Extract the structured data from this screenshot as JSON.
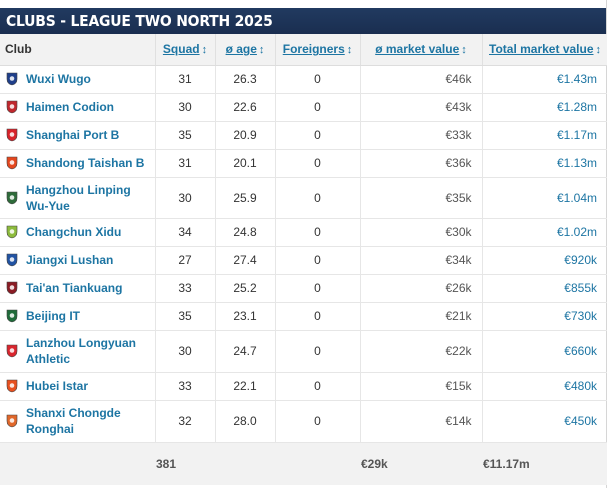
{
  "title": "CLUBS - LEAGUE TWO NORTH 2025",
  "columns": {
    "club": "Club",
    "squad": "Squad",
    "age": "ø age",
    "foreigners": "Foreigners",
    "market_value": "ø market value",
    "total_market_value": "Total market value",
    "sort_icon": "↕"
  },
  "rows": [
    {
      "club": "Wuxi Wugo",
      "squad": "31",
      "age": "26.3",
      "foreigners": "0",
      "market_value": "€46k",
      "total_market_value": "€1.43m",
      "crest_color": "#1f3f8a",
      "crest_icon": "wuxi-wugo-crest-icon"
    },
    {
      "club": "Haimen Codion",
      "squad": "30",
      "age": "22.6",
      "foreigners": "0",
      "market_value": "€43k",
      "total_market_value": "€1.28m",
      "crest_color": "#c0272d",
      "crest_icon": "haimen-codion-crest-icon"
    },
    {
      "club": "Shanghai Port B",
      "squad": "35",
      "age": "20.9",
      "foreigners": "0",
      "market_value": "€33k",
      "total_market_value": "€1.17m",
      "crest_color": "#d8232a",
      "crest_icon": "shanghai-port-b-crest-icon"
    },
    {
      "club": "Shandong Taishan B",
      "squad": "31",
      "age": "20.1",
      "foreigners": "0",
      "market_value": "€36k",
      "total_market_value": "€1.13m",
      "crest_color": "#e4471e",
      "crest_icon": "shandong-taishan-b-crest-icon"
    },
    {
      "club": "Hangzhou Linping Wu-Yue",
      "squad": "30",
      "age": "25.9",
      "foreigners": "0",
      "market_value": "€35k",
      "total_market_value": "€1.04m",
      "crest_color": "#2e6b3a",
      "crest_icon": "hangzhou-linping-wu-yue-crest-icon"
    },
    {
      "club": "Changchun Xidu",
      "squad": "34",
      "age": "24.8",
      "foreigners": "0",
      "market_value": "€30k",
      "total_market_value": "€1.02m",
      "crest_color": "#8dbb3c",
      "crest_icon": "changchun-xidu-crest-icon"
    },
    {
      "club": "Jiangxi Lushan",
      "squad": "27",
      "age": "27.4",
      "foreigners": "0",
      "market_value": "€34k",
      "total_market_value": "€920k",
      "crest_color": "#2153a3",
      "crest_icon": "jiangxi-lushan-crest-icon"
    },
    {
      "club": "Tai'an Tiankuang",
      "squad": "33",
      "age": "25.2",
      "foreigners": "0",
      "market_value": "€26k",
      "total_market_value": "€855k",
      "crest_color": "#8a1c24",
      "crest_icon": "taian-tiankuang-crest-icon"
    },
    {
      "club": "Beijing IT",
      "squad": "35",
      "age": "23.1",
      "foreigners": "0",
      "market_value": "€21k",
      "total_market_value": "€730k",
      "crest_color": "#1f6b3a",
      "crest_icon": "beijing-it-crest-icon"
    },
    {
      "club": "Lanzhou Longyuan Athletic",
      "squad": "30",
      "age": "24.7",
      "foreigners": "0",
      "market_value": "€22k",
      "total_market_value": "€660k",
      "crest_color": "#d9262e",
      "crest_icon": "lanzhou-longyuan-athletic-crest-icon"
    },
    {
      "club": "Hubei Istar",
      "squad": "33",
      "age": "22.1",
      "foreigners": "0",
      "market_value": "€15k",
      "total_market_value": "€480k",
      "crest_color": "#e8501f",
      "crest_icon": "hubei-istar-crest-icon"
    },
    {
      "club": "Shanxi Chongde Ronghai",
      "squad": "32",
      "age": "28.0",
      "foreigners": "0",
      "market_value": "€14k",
      "total_market_value": "€450k",
      "crest_color": "#e0672a",
      "crest_icon": "shanxi-chongde-ronghai-crest-icon"
    }
  ],
  "totals": {
    "squad": "381",
    "age": "",
    "foreigners": "",
    "market_value": "€29k",
    "total_market_value": "€11.17m"
  },
  "colors": {
    "title_bg": "#1d3557",
    "link": "#1d75a3",
    "header_bg": "#f2f2f2"
  }
}
